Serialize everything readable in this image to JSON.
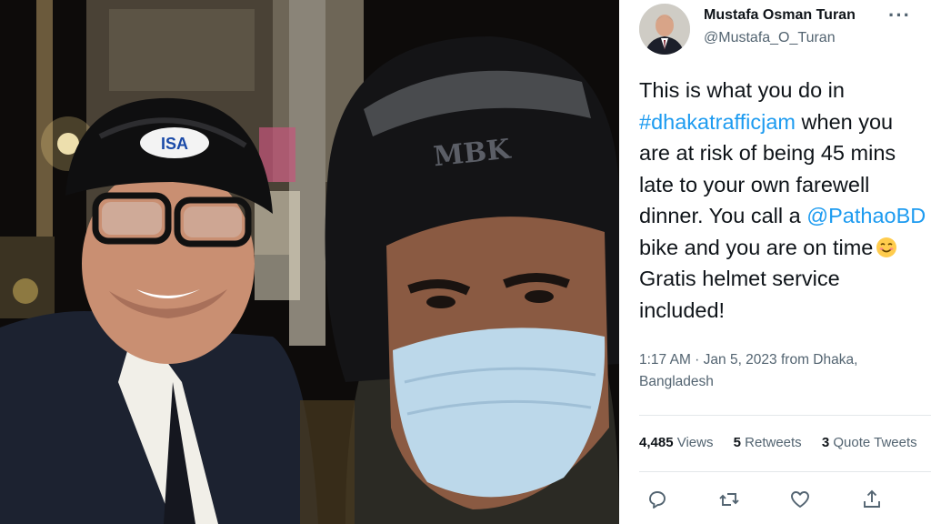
{
  "photo": {
    "alt_icons": [
      "selfie-photo"
    ],
    "helmet_left_logo": "ISA",
    "helmet_right_logo": "MBK"
  },
  "tweet": {
    "author": {
      "name": "Mustafa Osman Turan",
      "handle": "@Mustafa_O_Turan"
    },
    "more_label": "···",
    "text": {
      "part1": "This is what you do in ",
      "hashtag": "#dhakatrafficjam",
      "part2": " when you are at risk of being 45 mins late to your own farewell dinner. You call a ",
      "mention": "@PathaoBD",
      "part3": " bike and you are on time",
      "part4": " Gratis helmet service included!"
    },
    "meta": {
      "time": "1:17 AM",
      "sep": " · ",
      "date": "Jan 5, 2023",
      "location_prefix": " from ",
      "location": "Dhaka, Bangladesh"
    },
    "stats": {
      "views_count": "4,485",
      "views_label": " Views",
      "retweets_count": "5",
      "retweets_label": " Retweets",
      "quotes_count": "3",
      "quotes_label": " Quote Tweets"
    },
    "actions": [
      "reply-icon",
      "retweet-icon",
      "like-icon",
      "share-icon"
    ]
  },
  "colors": {
    "link": "#1d9bf0",
    "text": "#0f1419",
    "secondary": "#536471"
  }
}
